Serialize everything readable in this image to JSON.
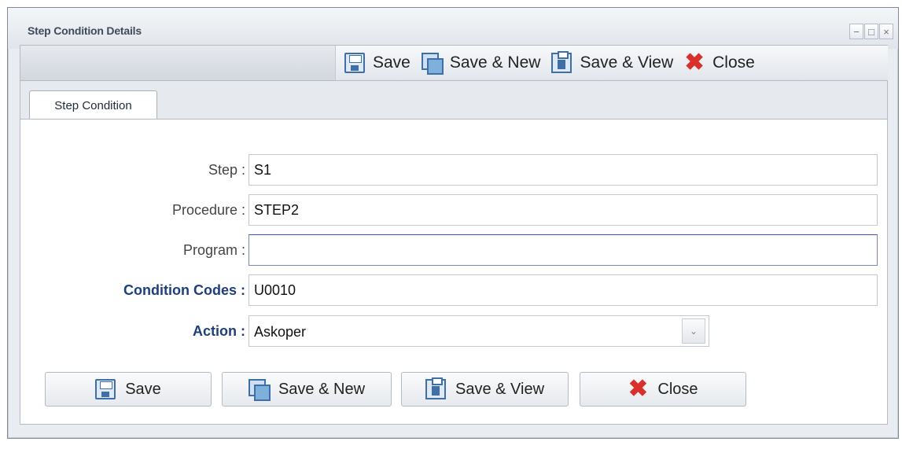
{
  "window": {
    "title": "Step Condition Details",
    "controls": {
      "minimize": "−",
      "maximize": "□",
      "close": "×"
    }
  },
  "toolbar": {
    "save_label": "Save",
    "save_new_label": "Save & New",
    "save_view_label": "Save & View",
    "close_label": "Close"
  },
  "tabs": [
    {
      "label": "Step Condition",
      "active": true
    }
  ],
  "form": {
    "step": {
      "label": "Step :",
      "value": "S1"
    },
    "procedure": {
      "label": "Procedure :",
      "value": "STEP2"
    },
    "program": {
      "label": "Program :",
      "value": ""
    },
    "condition_codes": {
      "label": "Condition Codes :",
      "value": "U0010",
      "required": true
    },
    "action": {
      "label": "Action :",
      "value": "Askoper",
      "required": true,
      "arrow": "⌄"
    }
  },
  "buttons": {
    "save_label": "Save",
    "save_new_label": "Save & New",
    "save_view_label": "Save & View",
    "close_label": "Close"
  },
  "icons": {
    "save": "save-icon",
    "save_new": "save-new-icon",
    "save_view": "save-view-icon",
    "close": "close-icon",
    "close_glyph": "✖"
  },
  "colors": {
    "required_label": "#1d3f7a",
    "close_icon": "#d9302c",
    "icon_blue": "#3f6fa8"
  }
}
